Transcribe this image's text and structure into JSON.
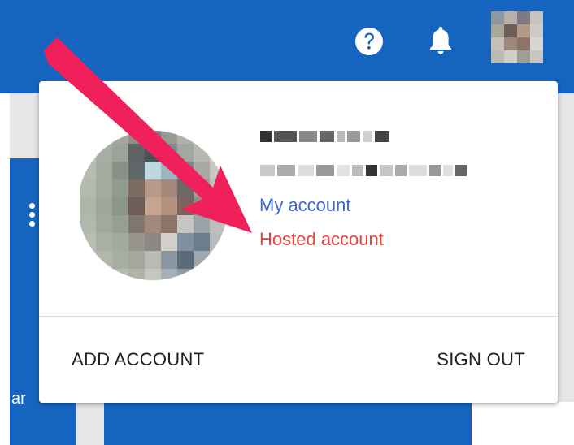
{
  "colors": {
    "topbar": "#1565c0",
    "link_primary": "#3b67d4",
    "link_hosted": "#e0463b",
    "arrow": "#f0205a"
  },
  "header": {
    "help_icon": "help-icon",
    "notifications_icon": "bell-icon",
    "avatar_icon": "avatar"
  },
  "background": {
    "left_card_partial_text": "ar"
  },
  "account_menu": {
    "my_account_label": "My account",
    "hosted_account_label": "Hosted account",
    "add_account_label": "ADD ACCOUNT",
    "sign_out_label": "SIGN OUT"
  },
  "annotation": {
    "arrow_icon": "arrow-icon"
  }
}
